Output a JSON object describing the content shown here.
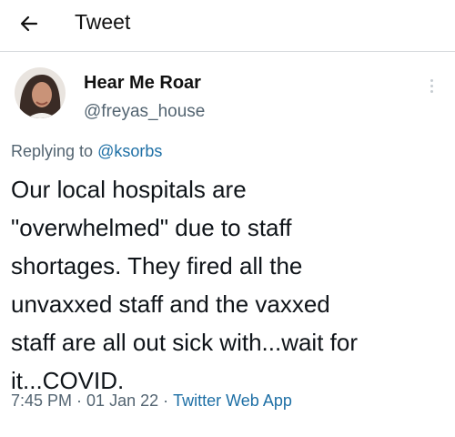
{
  "header": {
    "back_icon": "arrow-left-icon",
    "title": "Tweet"
  },
  "author": {
    "avatar_icon": "user-avatar",
    "name": "Hear Me Roar",
    "handle": "@freyas_house"
  },
  "more_icon": "more-vertical-icon",
  "reply": {
    "prefix": "Replying to ",
    "handle": "@ksorbs"
  },
  "tweet": {
    "text": "Our local hospitals are\n\"overwhelmed\" due to staff\nshortages. They fired all the\nunvaxxed staff and the vaxxed\nstaff are all out sick with...wait for\nit...COVID.",
    "time": "7:45 PM",
    "date": "01 Jan 22",
    "source": "Twitter Web App",
    "separator": "·"
  },
  "colors": {
    "text": "#0f1419",
    "secondary": "#536471",
    "link": "#1d6fa5"
  }
}
